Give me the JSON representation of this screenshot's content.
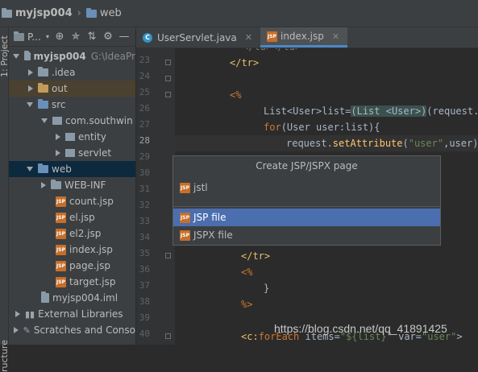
{
  "breadcrumb": {
    "project": "myjsp004",
    "folder": "web"
  },
  "left_strip": {
    "project_label": "1: Project",
    "structure_label": "ructure"
  },
  "toolbar": {
    "view_label": "P..."
  },
  "tree": [
    {
      "label": "myjsp004",
      "suffix": "G:\\IdeaPr",
      "icon": "module-folder-icon",
      "arrow": "down",
      "indent": 10
    },
    {
      "label": ".idea",
      "icon": "folder-icon",
      "arrow": "right",
      "indent": 22
    },
    {
      "label": "out",
      "icon": "folder-icon",
      "arrow": "right",
      "indent": 22
    },
    {
      "label": "src",
      "icon": "source-folder-icon",
      "arrow": "down",
      "indent": 22
    },
    {
      "label": "com.southwin",
      "icon": "package-icon",
      "arrow": "down",
      "indent": 40
    },
    {
      "label": "entity",
      "icon": "package-icon",
      "arrow": "right",
      "indent": 58
    },
    {
      "label": "servlet",
      "icon": "package-icon",
      "arrow": "right",
      "indent": 58
    },
    {
      "label": "web",
      "icon": "web-folder-icon",
      "arrow": "down",
      "indent": 22
    },
    {
      "label": "WEB-INF",
      "icon": "folder-icon",
      "arrow": "right",
      "indent": 40
    },
    {
      "label": "count.jsp",
      "icon": "jsp-file-icon",
      "arrow": "",
      "indent": 56
    },
    {
      "label": "el.jsp",
      "icon": "jsp-file-icon",
      "arrow": "",
      "indent": 56
    },
    {
      "label": "el2.jsp",
      "icon": "jsp-file-icon",
      "arrow": "",
      "indent": 56
    },
    {
      "label": "index.jsp",
      "icon": "jsp-file-icon",
      "arrow": "",
      "indent": 56
    },
    {
      "label": "page.jsp",
      "icon": "jsp-file-icon",
      "arrow": "",
      "indent": 56
    },
    {
      "label": "target.jsp",
      "icon": "jsp-file-icon",
      "arrow": "",
      "indent": 56
    },
    {
      "label": "myjsp004.iml",
      "icon": "iml-file-icon",
      "arrow": "",
      "indent": 38
    },
    {
      "label": "External Libraries",
      "icon": "libraries-icon",
      "arrow": "right",
      "indent": 6
    },
    {
      "label": "Scratches and Conso",
      "icon": "scratches-icon",
      "arrow": "",
      "indent": 6
    }
  ],
  "tabs": [
    {
      "label": "UserServlet.java",
      "icon": "java-class-icon",
      "active": false
    },
    {
      "label": "index.jsp",
      "icon": "jsp-file-icon",
      "active": true
    }
  ],
  "line_numbers": [
    "23",
    "24",
    "25",
    "26",
    "27",
    "28",
    "29",
    "30",
    "31",
    "32",
    "33",
    "34",
    "35",
    "36",
    "37",
    "38",
    "39",
    "40"
  ],
  "popup": {
    "title": "Create JSP/JSPX page",
    "items": [
      "jstl",
      "JSP file",
      "JSPX file"
    ]
  },
  "watermark": "https://blog.csdn.net/qq_41891425",
  "colors": {
    "selection": "#4b6eaf",
    "tree_selection": "#0d293e",
    "tab_underline": "#4a88c7"
  }
}
